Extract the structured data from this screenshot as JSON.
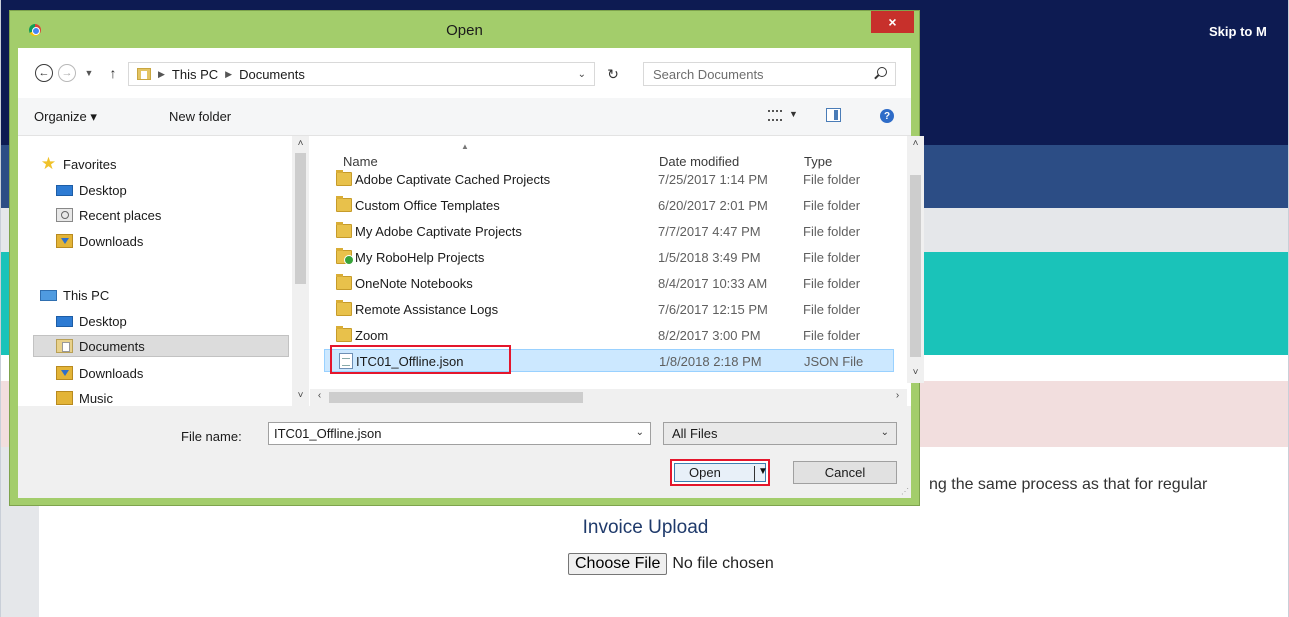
{
  "page": {
    "skip_link": "Skip to M",
    "body_text": "ng the same process as that for regular",
    "invoice_title": "Invoice Upload",
    "choose_file_label": "Choose File",
    "no_file_text": "No file chosen"
  },
  "dialog": {
    "title": "Open",
    "close_glyph": "×",
    "breadcrumb": [
      "This PC",
      "Documents"
    ],
    "search_placeholder": "Search Documents",
    "toolbar": {
      "organize": "Organize ▾",
      "new_folder": "New folder"
    },
    "nav_pane": {
      "items": [
        {
          "label": "Favorites",
          "icon": "star-icon"
        },
        {
          "label": "Desktop",
          "icon": "desktop-icon"
        },
        {
          "label": "Recent places",
          "icon": "recent-places-icon"
        },
        {
          "label": "Downloads",
          "icon": "downloads-icon"
        },
        {
          "label": "This PC",
          "icon": "this-pc-icon"
        },
        {
          "label": "Desktop",
          "icon": "desktop-icon"
        },
        {
          "label": "Documents",
          "icon": "documents-icon",
          "selected": true
        },
        {
          "label": "Downloads",
          "icon": "downloads-icon"
        },
        {
          "label": "Music",
          "icon": "music-icon"
        }
      ]
    },
    "columns": {
      "name": "Name",
      "date": "Date modified",
      "type": "Type"
    },
    "files": [
      {
        "name": "Adobe Captivate Cached Projects",
        "date": "7/25/2017 1:14 PM",
        "type": "File folder",
        "icon": "folder-icon"
      },
      {
        "name": "Custom Office Templates",
        "date": "6/20/2017 2:01 PM",
        "type": "File folder",
        "icon": "folder-icon"
      },
      {
        "name": "My Adobe Captivate Projects",
        "date": "7/7/2017 4:47 PM",
        "type": "File folder",
        "icon": "folder-icon"
      },
      {
        "name": "My RoboHelp Projects",
        "date": "1/5/2018 3:49 PM",
        "type": "File folder",
        "icon": "special-folder-icon"
      },
      {
        "name": "OneNote Notebooks",
        "date": "8/4/2017 10:33 AM",
        "type": "File folder",
        "icon": "folder-icon"
      },
      {
        "name": "Remote Assistance Logs",
        "date": "7/6/2017 12:15 PM",
        "type": "File folder",
        "icon": "folder-icon"
      },
      {
        "name": "Zoom",
        "date": "8/2/2017 3:00 PM",
        "type": "File folder",
        "icon": "folder-icon"
      },
      {
        "name": "ITC01_Offline.json",
        "date": "1/8/2018 2:18 PM",
        "type": "JSON File",
        "icon": "json-file-icon",
        "selected": true
      }
    ],
    "file_name_label": "File name:",
    "file_name_value": "ITC01_Offline.json",
    "file_type_filter": "All Files",
    "open_label": "Open",
    "cancel_label": "Cancel"
  },
  "colors": {
    "titlebar": "#a3cd6b",
    "close_button": "#c7302b",
    "highlight": "#e4162c",
    "selection": "#cce8ff",
    "navy": "#0d1b52",
    "teal": "#1ac3b9"
  }
}
